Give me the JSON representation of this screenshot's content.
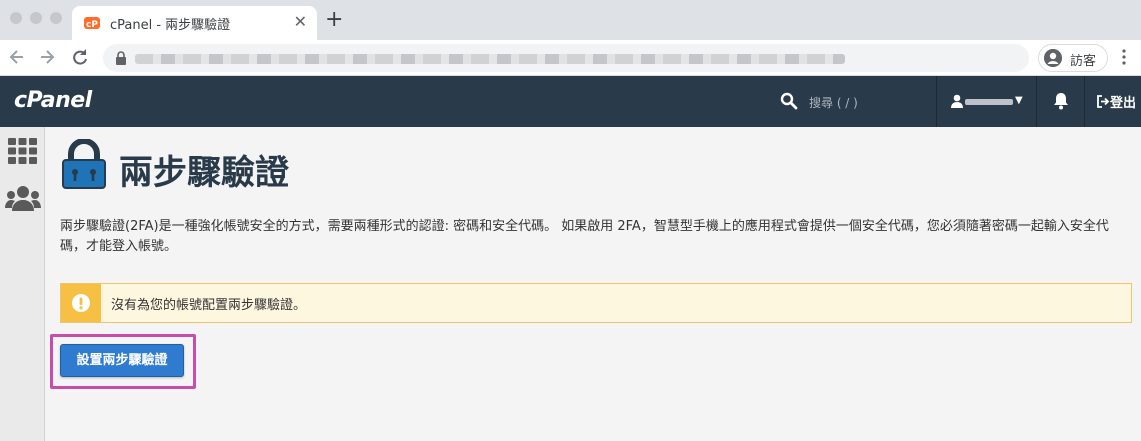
{
  "browser": {
    "tab_title": "cPanel - 兩步驟驗證",
    "tab_close": "✕",
    "new_tab": "+",
    "profile_label": "訪客"
  },
  "header": {
    "logo": "cPanel",
    "search_placeholder": "搜尋 ( / )",
    "logout_label": "登出"
  },
  "page": {
    "title": "兩步驟驗證",
    "description": "兩步驟驗證(2FA)是一種強化帳號安全的方式，需要兩種形式的認證: 密碼和安全代碼。 如果啟用 2FA，智慧型手機上的應用程式會提供一個安全代碼，您必須隨著密碼一起輸入安全代碼，才能登入帳號。",
    "alert_text": "沒有為您的帳號配置兩步驟驗證。",
    "setup_button": "設置兩步驟驗證"
  },
  "colors": {
    "header_bg": "#293a4a",
    "primary_button": "#2e7bcf",
    "alert_strip": "#f5c044",
    "highlight_border": "#c94cab"
  },
  "icons": [
    "cpanel-favicon",
    "back-arrow-icon",
    "forward-arrow-icon",
    "reload-icon",
    "lock-icon",
    "guest-avatar-icon",
    "menu-dots-icon",
    "search-icon",
    "user-icon",
    "bell-icon",
    "logout-icon",
    "grid-icon",
    "users-icon",
    "padlock-title-icon",
    "warning-icon"
  ]
}
